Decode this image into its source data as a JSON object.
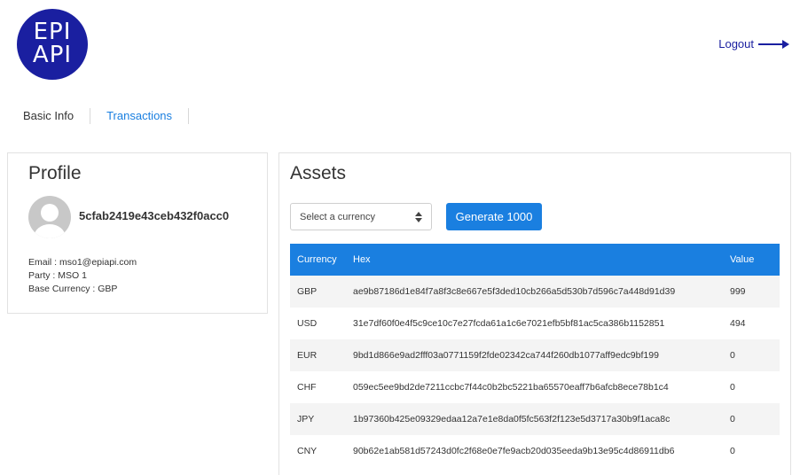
{
  "logo": {
    "top_text": "EPI",
    "bottom_text": "API"
  },
  "header": {
    "logout_label": "Logout"
  },
  "tabs": [
    {
      "label": "Basic Info",
      "active": false
    },
    {
      "label": "Transactions",
      "active": true
    }
  ],
  "profile": {
    "title": "Profile",
    "user_id": "5cfab2419e43ceb432f0acc0",
    "email": "Email : mso1@epiapi.com",
    "party": "Party : MSO 1",
    "base_currency": "Base Currency : GBP"
  },
  "assets": {
    "title": "Assets",
    "select_placeholder": "Select a currency",
    "generate_label": "Generate 1000",
    "columns": {
      "currency": "Currency",
      "hex": "Hex",
      "value": "Value"
    },
    "rows": [
      {
        "currency": "GBP",
        "hex": "ae9b87186d1e84f7a8f3c8e667e5f3ded10cb266a5d530b7d596c7a448d91d39",
        "value": "999"
      },
      {
        "currency": "USD",
        "hex": "31e7df60f0e4f5c9ce10c7e27fcda61a1c6e7021efb5bf81ac5ca386b1152851",
        "value": "494"
      },
      {
        "currency": "EUR",
        "hex": "9bd1d866e9ad2fff03a0771159f2fde02342ca744f260db1077aff9edc9bf199",
        "value": "0"
      },
      {
        "currency": "CHF",
        "hex": "059ec5ee9bd2de7211ccbc7f44c0b2bc5221ba65570eaff7b6afcb8ece78b1c4",
        "value": "0"
      },
      {
        "currency": "JPY",
        "hex": "1b97360b425e09329edaa12a7e1e8da0f5fc563f2f123e5d3717a30b9f1aca8c",
        "value": "0"
      },
      {
        "currency": "CNY",
        "hex": "90b62e1ab581d57243d0fc2f68e0e7fe9acb20d035eeda9b13e95c4d86911db6",
        "value": "0"
      }
    ]
  },
  "colors": {
    "brand_navy": "#1a1fa0",
    "accent_blue": "#1a7fe0"
  },
  "icons": {
    "logout": "arrow-right-icon",
    "select": "sort-caret-icon",
    "avatar": "user-avatar-icon"
  }
}
